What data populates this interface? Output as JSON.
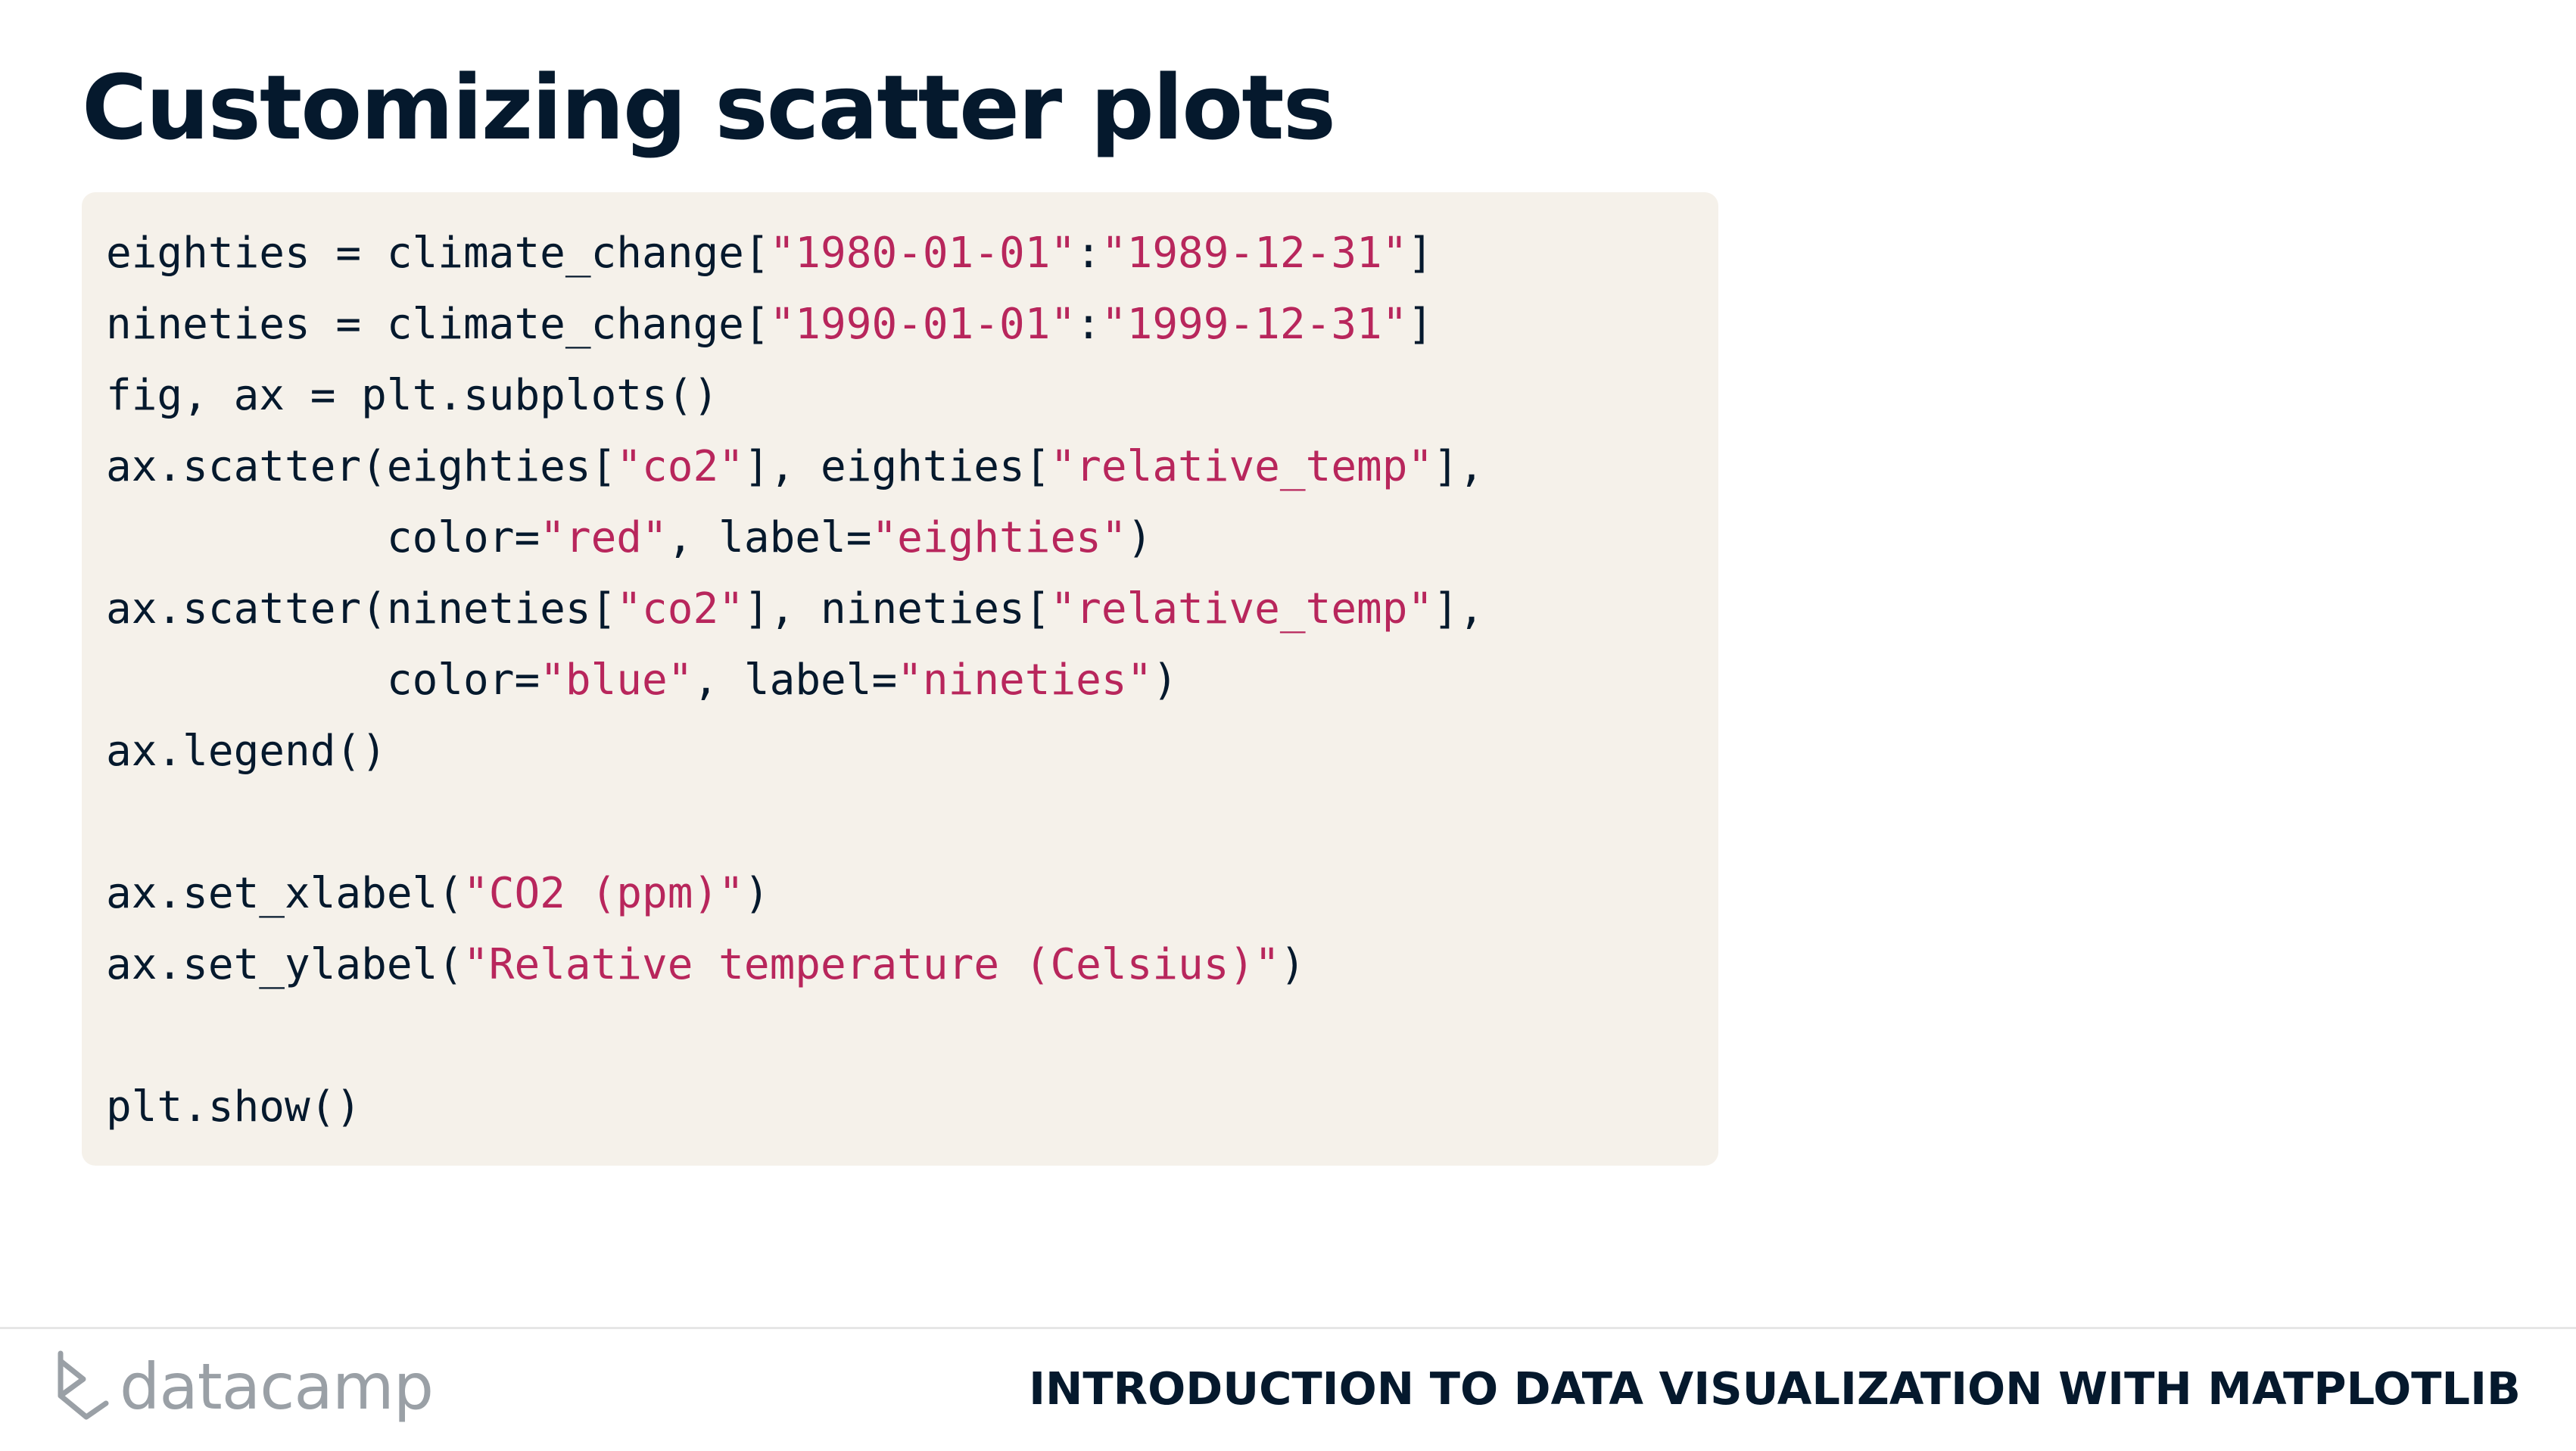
{
  "slide": {
    "title": "Customizing scatter plots"
  },
  "code": {
    "lines": [
      [
        {
          "t": "eighties = climate_change["
        },
        {
          "t": "\"1980-01-01\"",
          "s": 1
        },
        {
          "t": ":"
        },
        {
          "t": "\"1989-12-31\"",
          "s": 1
        },
        {
          "t": "]"
        }
      ],
      [
        {
          "t": "nineties = climate_change["
        },
        {
          "t": "\"1990-01-01\"",
          "s": 1
        },
        {
          "t": ":"
        },
        {
          "t": "\"1999-12-31\"",
          "s": 1
        },
        {
          "t": "]"
        }
      ],
      [
        {
          "t": "fig, ax = plt.subplots()"
        }
      ],
      [
        {
          "t": "ax.scatter(eighties["
        },
        {
          "t": "\"co2\"",
          "s": 1
        },
        {
          "t": "], eighties["
        },
        {
          "t": "\"relative_temp\"",
          "s": 1
        },
        {
          "t": "],"
        }
      ],
      [
        {
          "t": "           color="
        },
        {
          "t": "\"red\"",
          "s": 1
        },
        {
          "t": ", label="
        },
        {
          "t": "\"eighties\"",
          "s": 1
        },
        {
          "t": ")"
        }
      ],
      [
        {
          "t": "ax.scatter(nineties["
        },
        {
          "t": "\"co2\"",
          "s": 1
        },
        {
          "t": "], nineties["
        },
        {
          "t": "\"relative_temp\"",
          "s": 1
        },
        {
          "t": "],"
        }
      ],
      [
        {
          "t": "           color="
        },
        {
          "t": "\"blue\"",
          "s": 1
        },
        {
          "t": ", label="
        },
        {
          "t": "\"nineties\"",
          "s": 1
        },
        {
          "t": ")"
        }
      ],
      [
        {
          "t": "ax.legend()"
        }
      ],
      [],
      [
        {
          "t": "ax.set_xlabel("
        },
        {
          "t": "\"CO2 (ppm)\"",
          "s": 1
        },
        {
          "t": ")"
        }
      ],
      [
        {
          "t": "ax.set_ylabel("
        },
        {
          "t": "\"Relative temperature (Celsius)\"",
          "s": 1
        },
        {
          "t": ")"
        }
      ],
      [],
      [
        {
          "t": "plt.show()"
        }
      ]
    ]
  },
  "footer": {
    "logo_text": "datacamp",
    "course_title": "INTRODUCTION TO DATA VISUALIZATION WITH MATPLOTLIB"
  },
  "colors": {
    "title": "#05192d",
    "code_background": "#f5f1ea",
    "string_literal": "#b8265c",
    "logo_gray": "#9aa0a6"
  }
}
